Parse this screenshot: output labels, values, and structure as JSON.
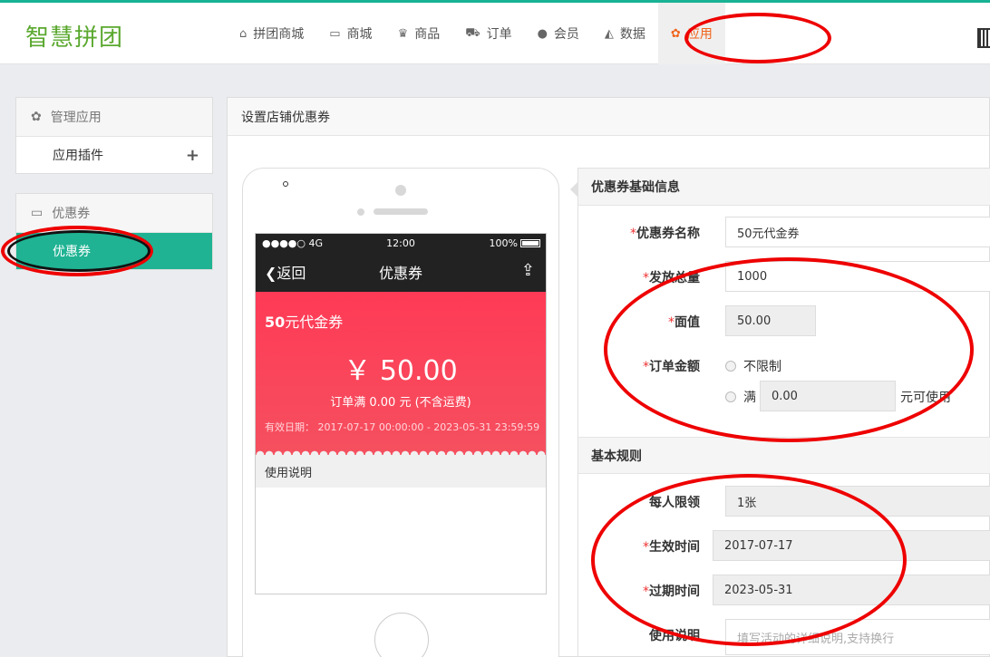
{
  "brand": {
    "logo_text": "智慧拼团"
  },
  "topnav": {
    "items": [
      {
        "label": "拼团商城",
        "icon": "home-icon",
        "glyph": "⌂"
      },
      {
        "label": "商城",
        "icon": "monitor-icon",
        "glyph": "▭"
      },
      {
        "label": "商品",
        "icon": "gift-icon",
        "glyph": "♛"
      },
      {
        "label": "订单",
        "icon": "cart-icon",
        "glyph": "⛟"
      },
      {
        "label": "会员",
        "icon": "user-icon",
        "glyph": "●"
      },
      {
        "label": "数据",
        "icon": "chart-icon",
        "glyph": "◭"
      },
      {
        "label": "应用",
        "icon": "apps-icon",
        "glyph": "✿"
      }
    ],
    "active": "应用"
  },
  "sidebar": {
    "group1": {
      "title": "管理应用",
      "items": [
        {
          "label": "应用插件"
        }
      ]
    },
    "group2": {
      "title": "优惠券",
      "items": [
        {
          "label": "优惠券"
        }
      ]
    }
  },
  "main": {
    "title": "设置店铺优惠券"
  },
  "preview": {
    "status": {
      "signal": "●●●●○ 4G",
      "time": "12:00",
      "battery": "100%"
    },
    "nav": {
      "back": "返回",
      "title": "优惠券"
    },
    "coupon": {
      "name_prefix": "50",
      "name_suffix": "元代金券",
      "amount": "￥ 50.00",
      "condition": "订单满 0.00 元 (不含运费)",
      "validity": "有效日期： 2017-07-17 00:00:00 - 2023-05-31 23:59:59"
    },
    "usage_label": "使用说明"
  },
  "form": {
    "basic_section": "优惠券基础信息",
    "name": {
      "label": "优惠券名称",
      "value": "50元代金券"
    },
    "total": {
      "label": "发放总量",
      "value": "1000"
    },
    "face_value": {
      "label": "面值",
      "value": "50.00"
    },
    "order_amount": {
      "label": "订单金额",
      "option_unlimited": "不限制",
      "option_min_prefix": "满",
      "min_value": "0.00",
      "option_min_suffix": "元可使用"
    },
    "rules_section": "基本规则",
    "per_limit": {
      "label": "每人限领",
      "value": "1张"
    },
    "start_time": {
      "label": "生效时间",
      "value": "2017-07-17"
    },
    "end_time": {
      "label": "过期时间",
      "value": "2023-05-31"
    },
    "description": {
      "label": "使用说明",
      "placeholder": "填写活动的详细说明,支持换行"
    }
  },
  "colors": {
    "accent": "#1fb393",
    "active_nav": "#f0631b",
    "coupon": "#ff3a56",
    "annotation": "#ee0000"
  }
}
